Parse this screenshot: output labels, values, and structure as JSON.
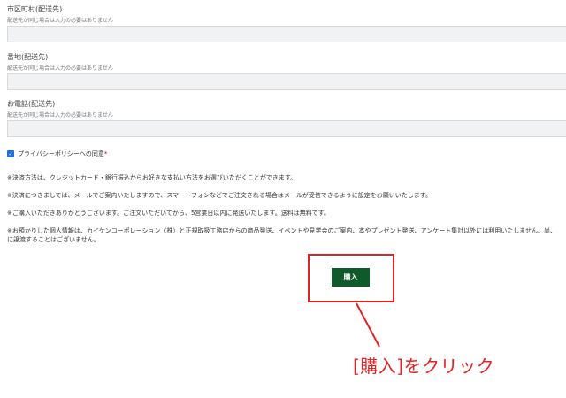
{
  "fields": [
    {
      "label": "市区町村(配送先)",
      "note": "配送先が同じ場合は入力の必要はありません"
    },
    {
      "label": "番地(配送先)",
      "note": "配送先が同じ場合は入力の必要はありません"
    },
    {
      "label": "お電話(配送先)",
      "note": "配送先が同じ場合は入力の必要はありません"
    }
  ],
  "privacy": {
    "label": "プライバシーポリシーへの同意",
    "required_mark": "*",
    "checked": true
  },
  "notes": [
    "※決済方法は、クレジットカード・銀行振込からお好きな支払い方法をお選びいただくことができます。",
    "※決済につきましては、メールでご案内いたしますので、スマートフォンなどでご注文される場合はメールが受信できるように設定をお願いいたします。",
    "※ご購入いただきありがとうございます。ご注文いただいてから、5営業日以内に発送いたします。送料は無料です。",
    "※お預かりした個人情報は、カイケンコーポレーション（株）と正規取扱工務店からの商品発送、イベントや見学会のご案内、本やプレゼント発送、アンケート集計以外には利用いたしません。尚、",
    "に譲渡することはございません。"
  ],
  "buy_button": {
    "label": "購入"
  },
  "callout": {
    "text": "[購入]をクリック"
  },
  "colors": {
    "button": "#0f5a2a",
    "annotation": "#e02424",
    "input_bg": "#f1f2f4"
  }
}
